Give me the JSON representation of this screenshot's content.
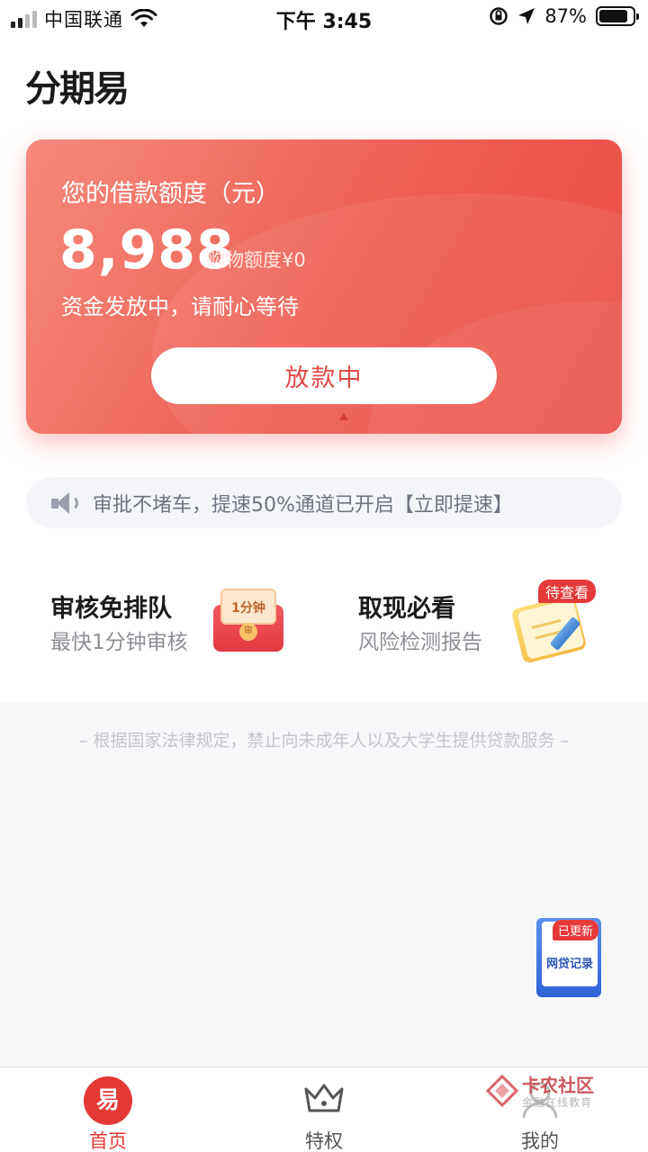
{
  "status_bar": {
    "carrier": "中国联通",
    "time": "下午 3:45",
    "battery_percent": "87%",
    "battery_level": 0.87
  },
  "app": {
    "logo": "分期易"
  },
  "credit_card": {
    "label": "您的借款额度（元）",
    "amount": "8,988",
    "shopping_quota": "购物额度¥0",
    "status": "资金发放中，请耐心等待",
    "button_label": "放款中",
    "colors": {
      "gradient_start": "#f58a7c",
      "gradient_end": "#ea4b44",
      "button_text": "#e34b45"
    }
  },
  "notice": {
    "text": "审批不堵车，提速50%通道已开启【立即提速】",
    "icon": "speaker-icon"
  },
  "features": [
    {
      "title": "审核免排队",
      "subtitle": "最快1分钟审核",
      "icon": "red-envelope-icon",
      "icon_text": "1分钟",
      "icon_seal": "审"
    },
    {
      "title": "取现必看",
      "subtitle": "风险检测报告",
      "icon": "notepad-icon",
      "badge": "待查看"
    }
  ],
  "legal_notice": "– 根据国家法律规定，禁止向未成年人以及大学生提供贷款服务 –",
  "floating_widget": {
    "badge": "已更新",
    "label": "网贷记录"
  },
  "tab_bar": {
    "active_color": "#e43a35",
    "tabs": [
      {
        "label": "首页",
        "icon": "home-logo-icon",
        "icon_glyph": "易",
        "active": true
      },
      {
        "label": "特权",
        "icon": "crown-icon",
        "active": false
      },
      {
        "label": "我的",
        "icon": "profile-icon",
        "active": false
      }
    ]
  },
  "watermark": {
    "title": "卡农社区",
    "subtitle": "金融在线教育"
  }
}
